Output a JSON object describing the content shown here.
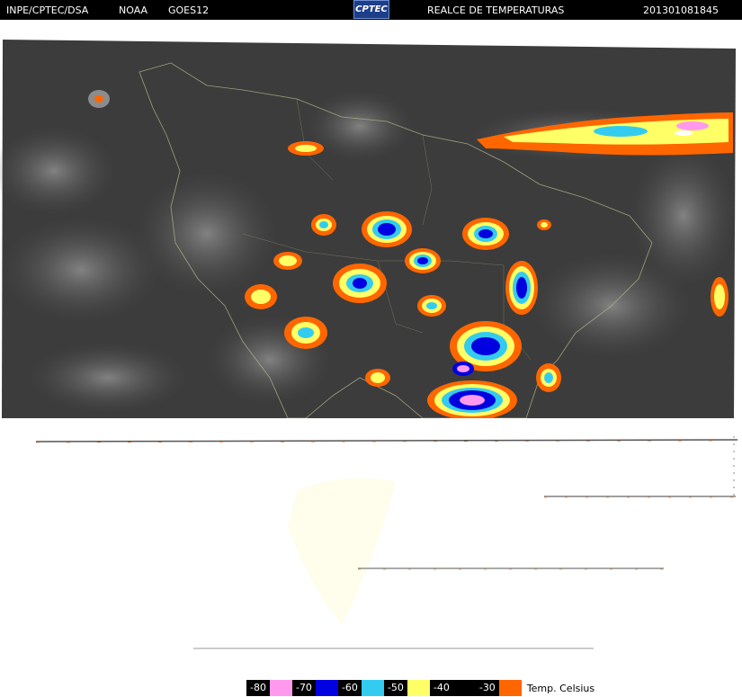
{
  "header": {
    "agency": "INPE/CPTEC/DSA",
    "source": "NOAA",
    "satellite": "GOES12",
    "logo_text": "CPTEC",
    "product": "REALCE DE TEMPERATURAS",
    "timestamp": "201301081845"
  },
  "legend": {
    "unit": "Temp. Celsius",
    "items": [
      {
        "label": "-80",
        "color": "#ff99ee"
      },
      {
        "label": "-70",
        "color": "#0000e0"
      },
      {
        "label": "-60",
        "color": "#33ccf0"
      },
      {
        "label": "-50",
        "color": "#ffff66"
      },
      {
        "label": "-40",
        "color": "#000000"
      },
      {
        "label": "-30",
        "color": "#ff6600"
      }
    ]
  }
}
